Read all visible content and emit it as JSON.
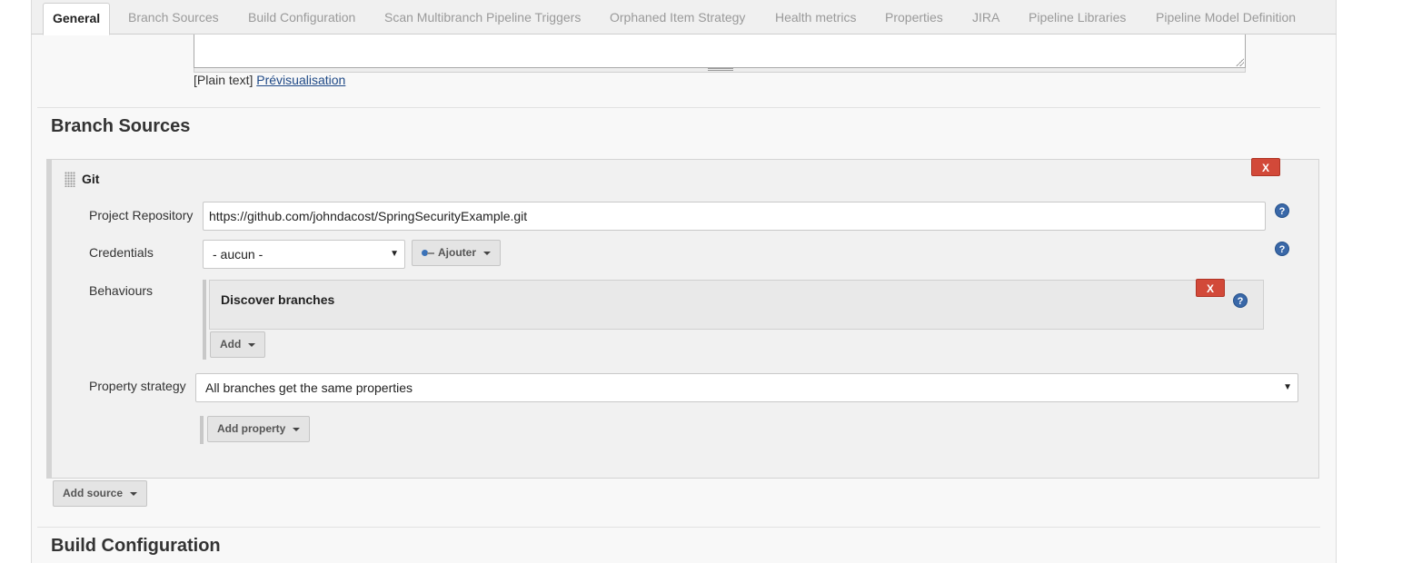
{
  "tabs": [
    {
      "label": "General",
      "active": true
    },
    {
      "label": "Branch Sources",
      "active": false
    },
    {
      "label": "Build Configuration",
      "active": false
    },
    {
      "label": "Scan Multibranch Pipeline Triggers",
      "active": false
    },
    {
      "label": "Orphaned Item Strategy",
      "active": false
    },
    {
      "label": "Health metrics",
      "active": false
    },
    {
      "label": "Properties",
      "active": false
    },
    {
      "label": "JIRA",
      "active": false
    },
    {
      "label": "Pipeline Libraries",
      "active": false
    },
    {
      "label": "Pipeline Model Definition",
      "active": false
    }
  ],
  "description": {
    "format_label": "[Plain text]",
    "preview_link": "Prévisualisation"
  },
  "branch_sources": {
    "title": "Branch Sources",
    "git": {
      "title": "Git",
      "delete_label": "X",
      "project_repository_label": "Project Repository",
      "project_repository_value": "https://github.com/johndacost/SpringSecurityExample.git",
      "credentials_label": "Credentials",
      "credentials_value": "- aucun -",
      "add_credentials_label": "Ajouter",
      "behaviours_label": "Behaviours",
      "behaviour_item": "Discover branches",
      "behaviour_delete_label": "X",
      "add_behaviour_label": "Add",
      "property_strategy_label": "Property strategy",
      "property_strategy_value": "All branches get the same properties",
      "add_property_label": "Add property"
    },
    "add_source_label": "Add source"
  },
  "build_configuration": {
    "title": "Build Configuration"
  },
  "help_glyph": "?",
  "select_caret": "▼",
  "colors": {
    "delete": "#d24939",
    "help": "#3a68a8",
    "link": "#204a87"
  }
}
